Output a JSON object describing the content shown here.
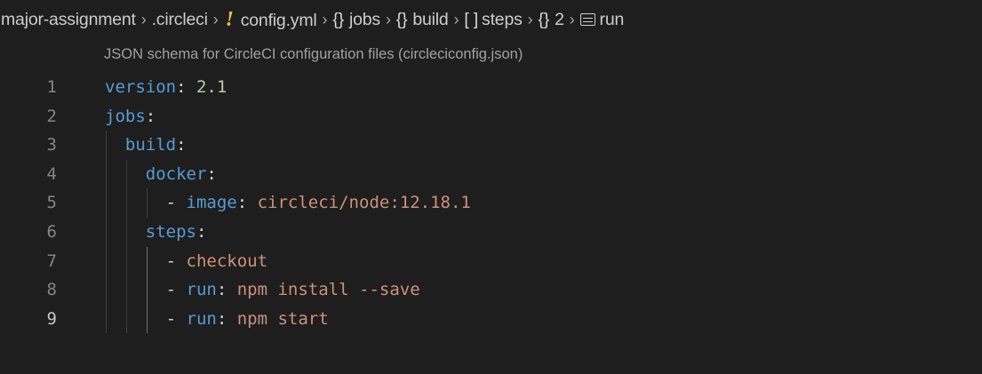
{
  "breadcrumb": {
    "items": [
      {
        "label": "major-assignment"
      },
      {
        "label": ".circleci"
      },
      {
        "icon": "yaml-file-icon",
        "icon_glyph": "!",
        "label": "config.yml"
      },
      {
        "icon": "object-icon",
        "icon_glyph": "{}",
        "label": "jobs"
      },
      {
        "icon": "object-icon",
        "icon_glyph": "{}",
        "label": "build"
      },
      {
        "icon": "array-icon",
        "icon_glyph": "[ ]",
        "label": "steps"
      },
      {
        "icon": "object-icon",
        "icon_glyph": "{}",
        "label": "2"
      },
      {
        "icon": "string-icon",
        "label": "run"
      }
    ],
    "separator": "›"
  },
  "schema_hint": "JSON schema for CircleCI configuration files (circleciconfig.json)",
  "editor": {
    "active_line": 9,
    "lines": [
      {
        "number": "1",
        "tokens": [
          {
            "t": "version",
            "c": "k"
          },
          {
            "t": ": ",
            "c": "p"
          },
          {
            "t": "2.1",
            "c": "n"
          }
        ]
      },
      {
        "number": "2",
        "tokens": [
          {
            "t": "jobs",
            "c": "k"
          },
          {
            "t": ":",
            "c": "p"
          }
        ]
      },
      {
        "number": "3",
        "tokens": [
          {
            "t": "  ",
            "c": "p"
          },
          {
            "t": "build",
            "c": "k"
          },
          {
            "t": ":",
            "c": "p"
          }
        ]
      },
      {
        "number": "4",
        "tokens": [
          {
            "t": "    ",
            "c": "p"
          },
          {
            "t": "docker",
            "c": "k"
          },
          {
            "t": ":",
            "c": "p"
          }
        ]
      },
      {
        "number": "5",
        "tokens": [
          {
            "t": "      - ",
            "c": "p"
          },
          {
            "t": "image",
            "c": "k"
          },
          {
            "t": ": ",
            "c": "p"
          },
          {
            "t": "circleci/node:12.18.1",
            "c": "s"
          }
        ]
      },
      {
        "number": "6",
        "tokens": [
          {
            "t": "    ",
            "c": "p"
          },
          {
            "t": "steps",
            "c": "k"
          },
          {
            "t": ":",
            "c": "p"
          }
        ]
      },
      {
        "number": "7",
        "tokens": [
          {
            "t": "      - ",
            "c": "p"
          },
          {
            "t": "checkout",
            "c": "s"
          }
        ]
      },
      {
        "number": "8",
        "tokens": [
          {
            "t": "      - ",
            "c": "p"
          },
          {
            "t": "run",
            "c": "k"
          },
          {
            "t": ": ",
            "c": "p"
          },
          {
            "t": "npm install --save",
            "c": "s"
          }
        ]
      },
      {
        "number": "9",
        "tokens": [
          {
            "t": "      - ",
            "c": "p"
          },
          {
            "t": "run",
            "c": "k"
          },
          {
            "t": ": ",
            "c": "p"
          },
          {
            "t": "npm start",
            "c": "s"
          }
        ]
      }
    ]
  },
  "colors": {
    "background": "#1e1e1e",
    "key": "#569cd6",
    "string": "#ce9178",
    "number": "#b5cea8",
    "punctuation": "#d4d4d4",
    "line_number": "#858585",
    "yaml_icon": "#e8c23a"
  }
}
